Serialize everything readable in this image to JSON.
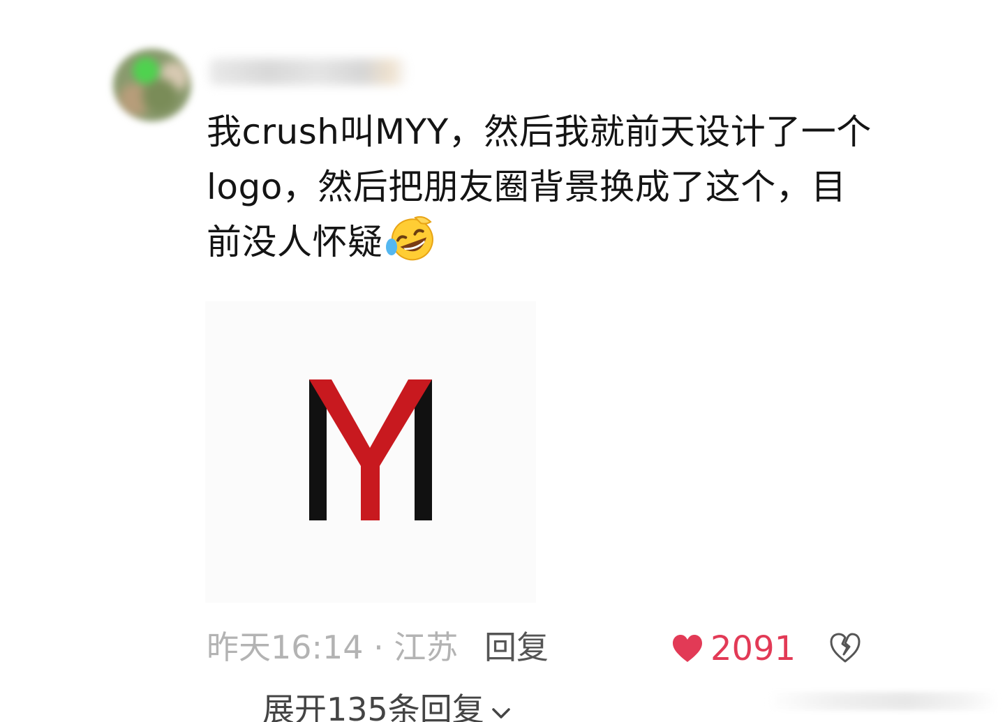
{
  "comment": {
    "text": "我crush叫MYY，然后我就前天设计了一个logo，然后把朋友圈背景换成了这个，目前没人怀疑",
    "emoji": "rolling-on-floor-laughing-emoji"
  },
  "image_post": {
    "logo_text": "MY"
  },
  "meta": {
    "time_location": "昨天16:14 · 江苏",
    "reply_label": "回复",
    "like_count": "2091"
  },
  "replies": {
    "expand_label": "展开135条回复"
  },
  "colors": {
    "like": "#e23a56",
    "logo_black": "#111111",
    "logo_red": "#c8191f",
    "meta_gray": "#b3b3b3"
  }
}
